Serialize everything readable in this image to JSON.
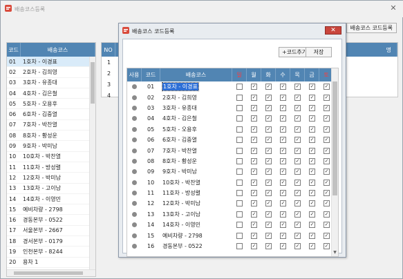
{
  "main": {
    "title": "배송코스등록",
    "code_reg_button": "배송코스 코드등록",
    "left_grid": {
      "headers": [
        "코드",
        "배송코스"
      ],
      "rows": [
        [
          "01",
          "1호차 - 이경표"
        ],
        [
          "02",
          "2호차 - 김희영"
        ],
        [
          "03",
          "3호차 - 유종대"
        ],
        [
          "04",
          "4호차 - 김은철"
        ],
        [
          "05",
          "5호차 - 오용후"
        ],
        [
          "06",
          "6호차 - 김중열"
        ],
        [
          "07",
          "7호차 - 박찬열"
        ],
        [
          "08",
          "8호차 - 황성운"
        ],
        [
          "09",
          "9호차 - 박미남"
        ],
        [
          "10",
          "10호차 - 박찬열"
        ],
        [
          "11",
          "11호차 - 방성렬"
        ],
        [
          "12",
          "12호차 - 박미남"
        ],
        [
          "13",
          "13호차 - 고이남"
        ],
        [
          "14",
          "14호차 - 이영민"
        ],
        [
          "15",
          "예비차량 - 2798"
        ],
        [
          "16",
          "경동본부 - 0522"
        ],
        [
          "17",
          "서울본부 - 2667"
        ],
        [
          "18",
          "경서본부 - 0179"
        ],
        [
          "19",
          "인천본부 - 8244"
        ],
        [
          "20",
          "용차 1"
        ]
      ]
    },
    "mid_grid": {
      "headers": [
        "NO"
      ],
      "right_header_fragment": "명",
      "rows": [
        "1",
        "2",
        "3",
        "4"
      ]
    }
  },
  "dialog": {
    "title": "배송코스 코드등록",
    "add_button": "+코드추가",
    "save_button": "저장",
    "headers": [
      "사용",
      "코드",
      "배송코스",
      "일",
      "월",
      "화",
      "수",
      "목",
      "금",
      "토"
    ],
    "rows": [
      {
        "code": "01",
        "name": "1호차 - 이경표"
      },
      {
        "code": "02",
        "name": "2호차 - 김희영"
      },
      {
        "code": "03",
        "name": "3호차 - 유종대"
      },
      {
        "code": "04",
        "name": "4호차 - 김은철"
      },
      {
        "code": "05",
        "name": "5호차 - 오용후"
      },
      {
        "code": "06",
        "name": "6호차 - 김중열"
      },
      {
        "code": "07",
        "name": "7호차 - 박찬열"
      },
      {
        "code": "08",
        "name": "8호차 - 황성운"
      },
      {
        "code": "09",
        "name": "9호차 - 박미남"
      },
      {
        "code": "10",
        "name": "10호차 - 박찬열"
      },
      {
        "code": "11",
        "name": "11호차 - 방성렬"
      },
      {
        "code": "12",
        "name": "12호차 - 박미남"
      },
      {
        "code": "13",
        "name": "13호차 - 고이남"
      },
      {
        "code": "14",
        "name": "14호차 - 이영민"
      },
      {
        "code": "15",
        "name": "예비차량 - 2798"
      },
      {
        "code": "16",
        "name": "경동본부 - 0522"
      }
    ],
    "day_checked": [
      false,
      true,
      true,
      true,
      true,
      true,
      true
    ]
  },
  "colors": {
    "grid_header": "#5185b3",
    "selected_row": "#d9ebf9",
    "weekend_header": "#ff3a3a",
    "close_button": "#c9463d"
  }
}
